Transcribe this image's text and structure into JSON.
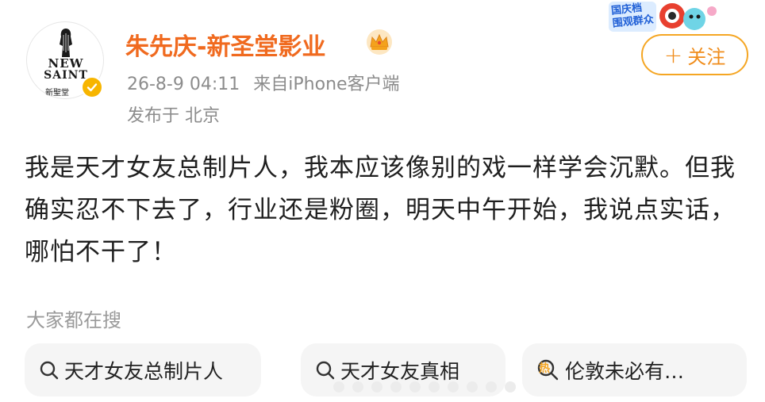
{
  "author": {
    "name": "朱先庆-新圣堂影业",
    "avatar_text": [
      "NEW",
      "SAINT",
      "新聖堂"
    ],
    "verified": true
  },
  "meta": {
    "timestamp": "26-8-9 04:11",
    "source_prefix": "来自",
    "source_device": "iPhone客户端",
    "location": "发布于 北京"
  },
  "follow_button": {
    "label": "关注",
    "icon": "plus-icon"
  },
  "badge": {
    "text_line1": "国庆档",
    "text_line2": "围观群众"
  },
  "post": {
    "text": "我是天才女友总制片人，我本应该像别的戏一样学会沉默。但我确实忍不下去了，行业还是粉圈，明天中午开始，我说点实话，哪怕不干了！"
  },
  "search_section": {
    "heading": "大家都在搜",
    "chips": [
      {
        "label": "天才女友总制片人",
        "icon": "search-icon"
      },
      {
        "label": "天才女友真相",
        "icon": "search-icon"
      },
      {
        "label": "伦敦未必有…",
        "icon": "hot-search-icon",
        "icon_text": "热"
      }
    ]
  },
  "colors": {
    "author_name": "#f06a1f",
    "follow_border": "#f5a623",
    "follow_text": "#f08c1a",
    "meta_text": "#8c8c8c",
    "chip_bg": "#f5f5f5"
  }
}
